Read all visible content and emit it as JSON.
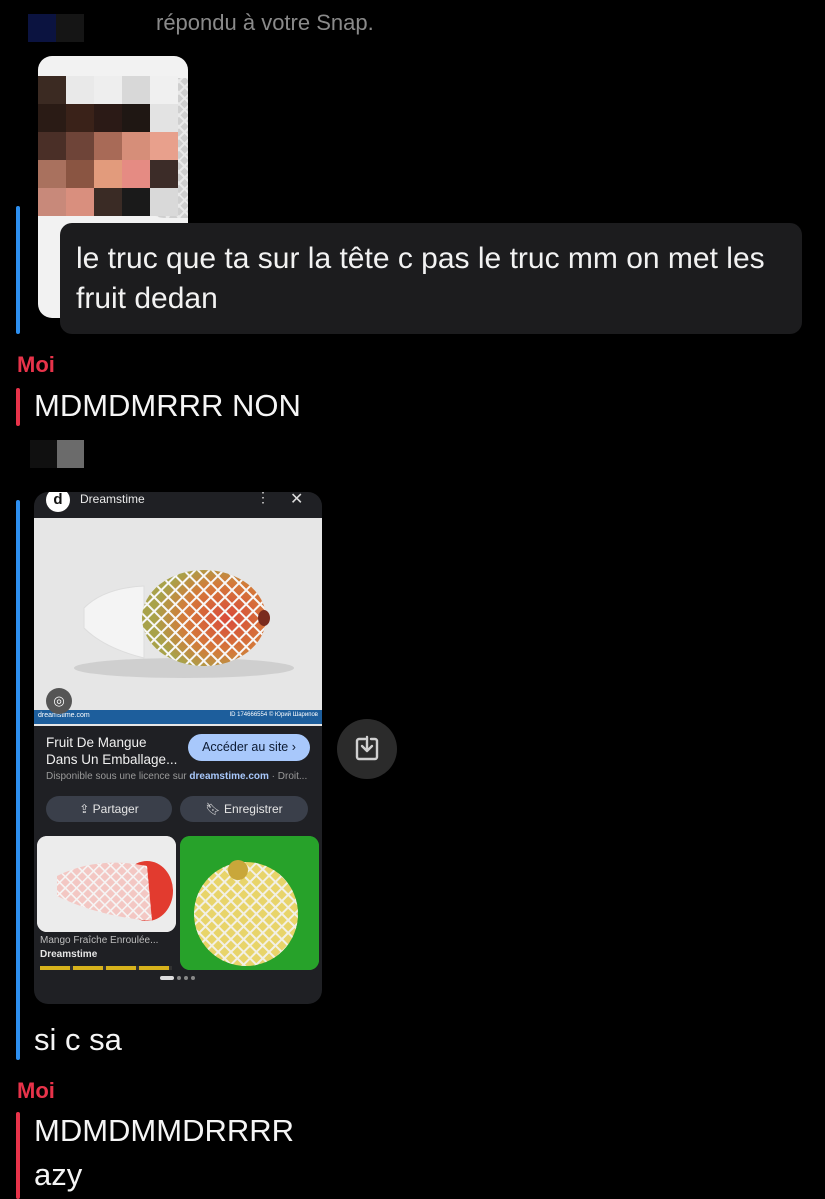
{
  "top_note": "répondu à votre Snap.",
  "reply": {
    "text_line1": "le truc que ta sur la tête c pas le truc mm on met les",
    "text_line2": "fruit dedan"
  },
  "messages": [
    {
      "sender": "Moi",
      "lines": [
        "MDMDMRRR NON"
      ]
    },
    {
      "sender": "Moi",
      "lines": [
        "MDMDMMDRRRR",
        "azy"
      ]
    }
  ],
  "friend_caption": "si c sa",
  "screenshot": {
    "app_title": "Dreamstime",
    "logo_letter": "d",
    "menu_icon": "more-vertical-icon",
    "close_icon": "close-icon",
    "watermark": "dreamstime.com",
    "image_id": "ID 174666554 © Юрий Шарипов",
    "result_title_line1": "Fruit De Mangue",
    "result_title_line2": "Dans Un Emballage...",
    "visit_button": "Accéder au site ›",
    "license_prefix": "Disponible sous une licence sur ",
    "license_site": "dreamstime.com",
    "license_suffix": " · Droit...",
    "share_button": "Partager",
    "save_button": "Enregistrer",
    "related_caption": "Mango Fraîche Enroulée...",
    "related_source": "Dreamstime"
  },
  "colors": {
    "sender_red": "#e8334a",
    "friend_blue": "#2d8ff0",
    "bubble_bg": "#1c1c1e",
    "google_blue_button": "#a8c8fb"
  }
}
